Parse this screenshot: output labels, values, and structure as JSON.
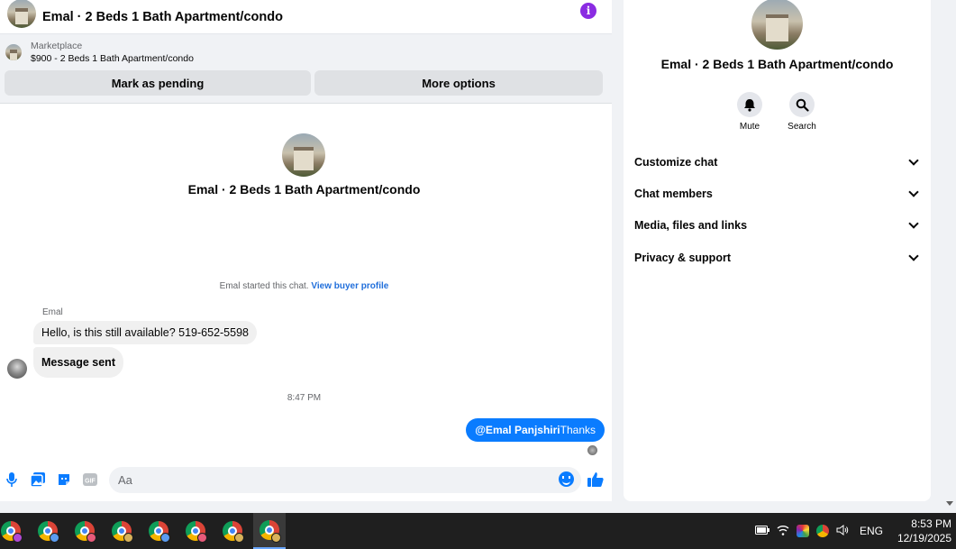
{
  "header": {
    "title": "Emal · 2 Beds 1 Bath Apartment/condo",
    "info_icon": "info-icon"
  },
  "listing": {
    "label": "Marketplace",
    "price_title": "$900 - 2 Beds 1 Bath Apartment/condo",
    "buttons": [
      "Mark as pending",
      "More options"
    ]
  },
  "thread": {
    "title": "Emal · 2 Beds 1 Bath Apartment/condo",
    "started_text": "Emal started this chat.",
    "view_profile_link": "View buyer profile",
    "sender_name": "Emal",
    "incoming": [
      "Hello, is this still available? 519-652-5598",
      "Message sent"
    ],
    "timestamp": "8:47 PM",
    "outgoing": {
      "mention": "@Emal Panjshiri",
      "text": "Thanks"
    }
  },
  "composer": {
    "placeholder": "Aa",
    "icons": [
      "microphone-icon",
      "image-icon",
      "sticker-icon",
      "gif-icon",
      "emoji-icon",
      "thumbs-up-icon"
    ]
  },
  "info_panel": {
    "title": "Emal · 2 Beds 1 Bath Apartment/condo",
    "actions": [
      {
        "label": "Mute",
        "icon": "bell-icon"
      },
      {
        "label": "Search",
        "icon": "search-icon"
      }
    ],
    "sections": [
      "Customize chat",
      "Chat members",
      "Media, files and links",
      "Privacy & support"
    ]
  },
  "taskbar": {
    "apps": [
      {
        "icon": "chrome-icon",
        "profile_color": "#b04ad6"
      },
      {
        "icon": "chrome-icon",
        "profile_color": "#5b9cf0"
      },
      {
        "icon": "chrome-icon",
        "profile_color": "#e85a7a"
      },
      {
        "icon": "chrome-icon",
        "profile_color": "#d9b35a"
      },
      {
        "icon": "chrome-icon",
        "profile_color": "#5b9cf0"
      },
      {
        "icon": "chrome-icon",
        "profile_color": "#e85a7a"
      },
      {
        "icon": "chrome-icon",
        "profile_color": "#d9b35a"
      },
      {
        "icon": "chrome-icon",
        "profile_color": "#d9b35a"
      }
    ],
    "language": "ENG",
    "time": "8:53 PM",
    "date": "12/19/2025"
  },
  "colors": {
    "accent": "#0a7cff",
    "info": "#8a2be2",
    "link": "#216fdb"
  }
}
